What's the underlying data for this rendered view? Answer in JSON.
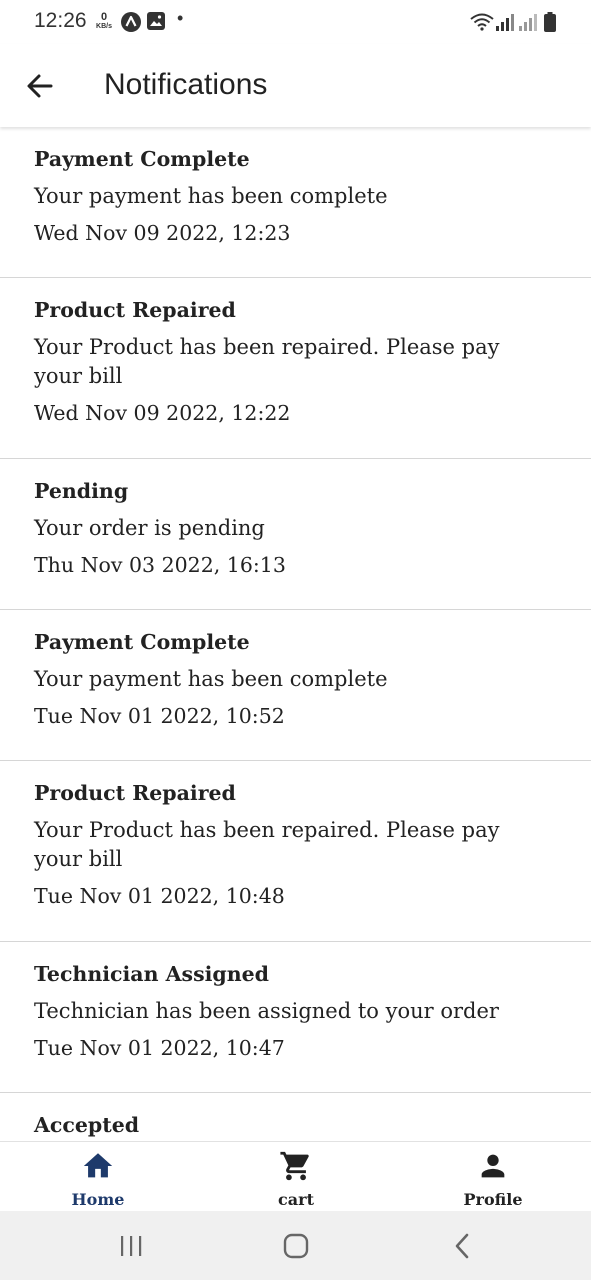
{
  "status_bar": {
    "time": "12:26",
    "net_speed_value": "0",
    "net_speed_unit": "KB/s",
    "dot": "•"
  },
  "app_bar": {
    "title": "Notifications"
  },
  "notifications": [
    {
      "title": "Payment Complete",
      "message": "Your payment has been complete",
      "date": "Wed Nov 09 2022, 12:23"
    },
    {
      "title": "Product Repaired",
      "message": "Your Product has been repaired. Please pay your bill",
      "date": "Wed Nov 09 2022, 12:22"
    },
    {
      "title": "Pending",
      "message": "Your order is pending",
      "date": "Thu Nov 03 2022, 16:13"
    },
    {
      "title": "Payment Complete",
      "message": "Your payment has been complete",
      "date": "Tue Nov 01 2022, 10:52"
    },
    {
      "title": "Product Repaired",
      "message": "Your Product has been repaired. Please pay your bill",
      "date": "Tue Nov 01 2022, 10:48"
    },
    {
      "title": "Technician Assigned",
      "message": "Technician has been assigned to your order",
      "date": "Tue Nov 01 2022, 10:47"
    },
    {
      "title": "Accepted"
    }
  ],
  "bottom_nav": {
    "items": [
      {
        "label": "Home",
        "icon": "home-icon",
        "active": true
      },
      {
        "label": "cart",
        "icon": "cart-icon",
        "active": false
      },
      {
        "label": "Profile",
        "icon": "person-icon",
        "active": false
      }
    ]
  },
  "colors": {
    "active_nav": "#1e3a6b",
    "inactive_nav": "#222222",
    "divider": "#d6d6d6",
    "system_nav_bg": "#f0f0f0"
  }
}
